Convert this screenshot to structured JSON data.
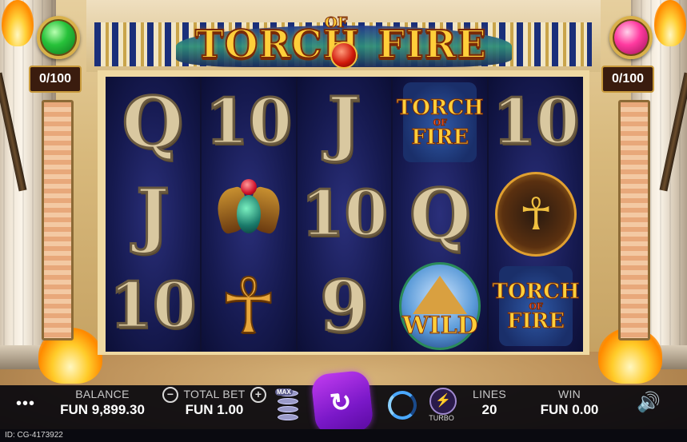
{
  "game": {
    "title_word1": "TORCH",
    "title_word2": "OF",
    "title_word3": "FIRE"
  },
  "meters": {
    "left_counter": "0/100",
    "right_counter": "0/100",
    "left_gem": "emerald-gem",
    "right_gem": "ruby-gem"
  },
  "reels": [
    [
      {
        "type": "text",
        "text": "Q"
      },
      {
        "type": "text",
        "text": "J"
      },
      {
        "type": "text",
        "text": "10"
      }
    ],
    [
      {
        "type": "text",
        "text": "10"
      },
      {
        "type": "scarab",
        "icon": "scarab-icon"
      },
      {
        "type": "ankh",
        "icon": "ankh-icon",
        "glyph": "☥"
      }
    ],
    [
      {
        "type": "text",
        "text": "J"
      },
      {
        "type": "text",
        "text": "10"
      },
      {
        "type": "text",
        "text": "9"
      }
    ],
    [
      {
        "type": "logo",
        "t": "TORCH",
        "o": "OF",
        "f": "FIRE"
      },
      {
        "type": "text",
        "text": "Q"
      },
      {
        "type": "wild",
        "text": "WILD"
      }
    ],
    [
      {
        "type": "text",
        "text": "10"
      },
      {
        "type": "anubis",
        "icon": "anubis-icon",
        "glyph": "☥"
      },
      {
        "type": "logo",
        "t": "TORCH",
        "o": "OF",
        "f": "FIRE"
      }
    ]
  ],
  "controls": {
    "menu_glyph": "•••",
    "balance_label": "BALANCE",
    "balance_value": "FUN 9,899.30",
    "total_bet_label": "TOTAL BET",
    "total_bet_value": "FUN 1.00",
    "minus_glyph": "−",
    "plus_glyph": "+",
    "max_label": "MAX",
    "spin_glyph": "↻",
    "turbo_glyph": "⚡",
    "turbo_label": "TURBO",
    "lines_label": "LINES",
    "lines_value": "20",
    "win_label": "WIN",
    "win_value": "FUN 0.00",
    "sound_glyph": "🔊",
    "game_id": "ID: CG-4173922"
  },
  "colors": {
    "spin_button": "#9a28e0",
    "reel_background": "#161a50",
    "title_gold": "#ffcf3a"
  }
}
